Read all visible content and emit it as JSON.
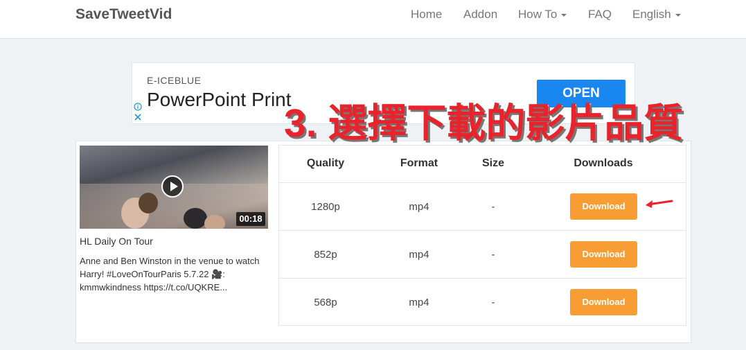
{
  "nav": {
    "brand": "SaveTweetVid",
    "items": [
      "Home",
      "Addon",
      "How To",
      "FAQ",
      "English"
    ]
  },
  "ad": {
    "brand": "E-ICEBLUE",
    "title": "PowerPoint Print",
    "button": "OPEN"
  },
  "overlay_text": "3. 選擇下載的影片品質",
  "video": {
    "duration": "00:18",
    "title": "HL Daily On Tour",
    "description": "Anne and Ben Winston in the venue to watch Harry! #LoveOnTourParis 5.7.22 🎥: kmmwkindness https://t.co/UQKRE..."
  },
  "table": {
    "headers": [
      "Quality",
      "Format",
      "Size",
      "Downloads"
    ],
    "rows": [
      {
        "quality": "1280p",
        "format": "mp4",
        "size": "-",
        "button": "Download"
      },
      {
        "quality": "852p",
        "format": "mp4",
        "size": "-",
        "button": "Download"
      },
      {
        "quality": "568p",
        "format": "mp4",
        "size": "-",
        "button": "Download"
      }
    ]
  },
  "colors": {
    "download_button": "#f79d34",
    "ad_button": "#1a86f0",
    "overlay_text": "#e8232b"
  }
}
